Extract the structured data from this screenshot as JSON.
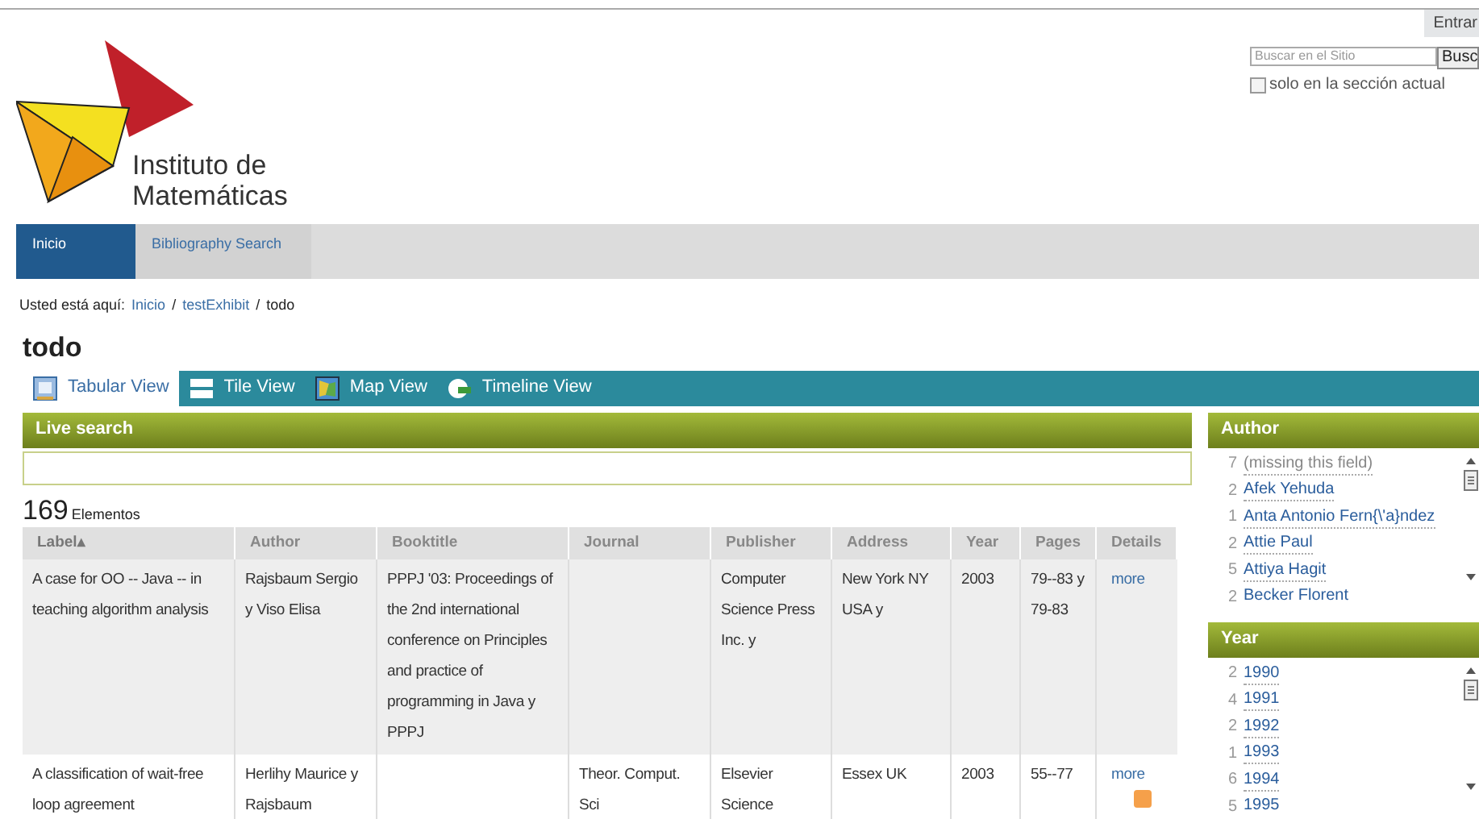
{
  "header": {
    "login": "Entrar",
    "search": {
      "placeholder": "Buscar en el Sitio",
      "button": "Busc"
    },
    "section_only": {
      "label": "solo en la sección actual",
      "checked": false
    },
    "logo": [
      "Instituto de",
      "Matemáticas"
    ]
  },
  "nav": [
    {
      "label": "Inicio",
      "selected": true
    },
    {
      "label": "Bibliography Search",
      "selected": false
    }
  ],
  "breadcrumb": {
    "prefix": "Usted está aquí:",
    "links": [
      "Inicio",
      "testExhibit"
    ],
    "separator": "/",
    "current": "todo"
  },
  "title": "todo",
  "views": [
    {
      "label": "Tabular View",
      "kind": "table",
      "selected": true
    },
    {
      "label": "Tile View",
      "kind": "tile",
      "selected": false
    },
    {
      "label": "Map View",
      "kind": "map",
      "selected": false
    },
    {
      "label": "Timeline View",
      "kind": "timeline",
      "selected": false
    }
  ],
  "live_search": {
    "title": "Live search"
  },
  "count": {
    "number": "169",
    "label": "Elementos"
  },
  "table": {
    "columns": [
      {
        "label": "Label▴",
        "sorted": true
      },
      {
        "label": "Author",
        "sorted": false
      },
      {
        "label": "Booktitle",
        "sorted": false
      },
      {
        "label": "Journal",
        "sorted": false
      },
      {
        "label": "Publisher",
        "sorted": false
      },
      {
        "label": "Address",
        "sorted": false
      },
      {
        "label": "Year",
        "sorted": false
      },
      {
        "label": "Pages",
        "sorted": false
      },
      {
        "label": "Details",
        "sorted": false
      }
    ],
    "rows": [
      {
        "cells": [
          "A case for OO -- Java -- in teaching algorithm analysis",
          "Rajsbaum Sergio y Viso Elisa",
          "PPPJ '03: Proceedings of the 2nd international conference on Principles and practice of programming in Java y PPPJ",
          "",
          "Computer Science Press Inc. y",
          "New York NY USA y",
          "2003",
          "79--83 y 79-83"
        ],
        "more": "more",
        "feed": false
      },
      {
        "cells": [
          "A classification of wait-free loop agreement",
          "Herlihy Maurice y Rajsbaum",
          "",
          "Theor. Comput. Sci",
          "Elsevier Science",
          "Essex UK",
          "2003",
          "55--77"
        ],
        "more": "more",
        "feed": true
      }
    ]
  },
  "facets": [
    {
      "title": "Author",
      "items": [
        {
          "count": "7",
          "label": "(missing this field)",
          "missing": true
        },
        {
          "count": "2",
          "label": "Afek Yehuda",
          "missing": false
        },
        {
          "count": "1",
          "label": "Anta Antonio Fern{\\'a}ndez",
          "missing": false
        },
        {
          "count": "2",
          "label": "Attie Paul",
          "missing": false
        },
        {
          "count": "5",
          "label": "Attiya Hagit",
          "missing": false
        },
        {
          "count": "2",
          "label": "Becker Florent",
          "missing": false
        }
      ]
    },
    {
      "title": "Year",
      "items": [
        {
          "count": "2",
          "label": "1990",
          "missing": false
        },
        {
          "count": "4",
          "label": "1991",
          "missing": false
        },
        {
          "count": "2",
          "label": "1992",
          "missing": false
        },
        {
          "count": "1",
          "label": "1993",
          "missing": false
        },
        {
          "count": "6",
          "label": "1994",
          "missing": false
        },
        {
          "count": "5",
          "label": "1995",
          "missing": false
        }
      ]
    }
  ]
}
